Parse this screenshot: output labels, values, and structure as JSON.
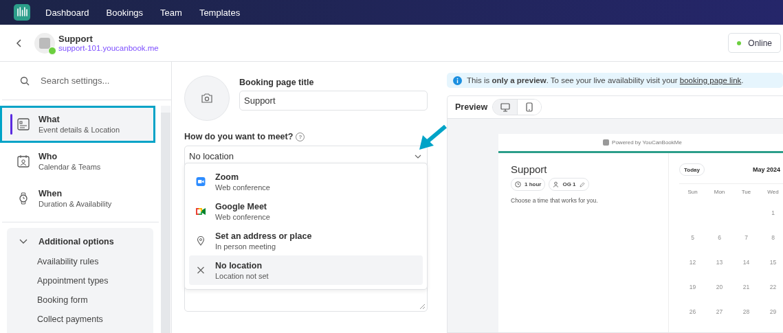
{
  "nav": {
    "items": [
      {
        "label": "Dashboard"
      },
      {
        "label": "Bookings"
      },
      {
        "label": "Team"
      },
      {
        "label": "Templates"
      }
    ]
  },
  "header": {
    "title": "Support",
    "link": "support-101.youcanbook.me",
    "online": true,
    "status": "Online"
  },
  "sidebar": {
    "search": {
      "placeholder": "Search settings..."
    },
    "sections": [
      {
        "kind": "what",
        "title": "What",
        "subtitle": "Event details & Location",
        "selected": true,
        "highlighted": true
      },
      {
        "kind": "who",
        "title": "Who",
        "subtitle": "Calendar & Teams",
        "selected": false,
        "highlighted": false
      },
      {
        "kind": "when",
        "title": "When",
        "subtitle": "Duration & Availability",
        "selected": false,
        "highlighted": false
      }
    ],
    "additional": {
      "title": "Additional options",
      "expanded": true,
      "children": [
        {
          "label": "Availability rules"
        },
        {
          "label": "Appointment types"
        },
        {
          "label": "Booking form"
        },
        {
          "label": "Collect payments"
        }
      ]
    }
  },
  "form": {
    "title_label": "Booking page title",
    "title_value": "Support",
    "meet_label": "How do you want to meet?",
    "help_icon": "?",
    "meet_value": "No location",
    "options": [
      {
        "kind": "zoom",
        "title": "Zoom",
        "subtitle": "Web conference",
        "selected": false
      },
      {
        "kind": "meet",
        "title": "Google Meet",
        "subtitle": "Web conference",
        "selected": false
      },
      {
        "kind": "place",
        "title": "Set an address or place",
        "subtitle": "In person meeting",
        "selected": false
      },
      {
        "kind": "none",
        "title": "No location",
        "subtitle": "Location not set",
        "selected": true
      }
    ]
  },
  "preview": {
    "notice": "This is **only a preview**. To see your live availability visit your",
    "notice_link": "booking page link",
    "notice_end": ".",
    "label": "Preview",
    "devices": [
      {
        "kind": "desktop",
        "selected": true
      },
      {
        "kind": "mobile",
        "selected": false
      }
    ],
    "powered": "Powered by YouCanBookMe",
    "title": "Support",
    "duration": "1 hour",
    "host": "OG 1",
    "prompt": "Choose a time that works for you.",
    "today": "Today",
    "month": "May 2024",
    "weekdays": [
      "Sun",
      "Mon",
      "Tue",
      "Wed"
    ],
    "weeks": [
      {
        "days": [
          {
            "kind": "blank"
          },
          {
            "kind": "blank"
          },
          {
            "kind": "blank"
          },
          {
            "kind": "day",
            "label": "1"
          }
        ]
      },
      {
        "days": [
          {
            "kind": "day",
            "label": "5"
          },
          {
            "kind": "day",
            "label": "6"
          },
          {
            "kind": "day",
            "label": "7"
          },
          {
            "kind": "day",
            "label": "8"
          }
        ]
      },
      {
        "days": [
          {
            "kind": "day",
            "label": "12"
          },
          {
            "kind": "day",
            "label": "13"
          },
          {
            "kind": "day",
            "label": "14"
          },
          {
            "kind": "day",
            "label": "15"
          }
        ]
      },
      {
        "days": [
          {
            "kind": "day",
            "label": "19"
          },
          {
            "kind": "day",
            "label": "20"
          },
          {
            "kind": "day",
            "label": "21"
          },
          {
            "kind": "day",
            "label": "22"
          }
        ]
      },
      {
        "days": [
          {
            "kind": "day",
            "label": "26"
          },
          {
            "kind": "day",
            "label": "27"
          },
          {
            "kind": "day",
            "label": "28"
          },
          {
            "kind": "day",
            "label": "29"
          }
        ]
      }
    ]
  }
}
